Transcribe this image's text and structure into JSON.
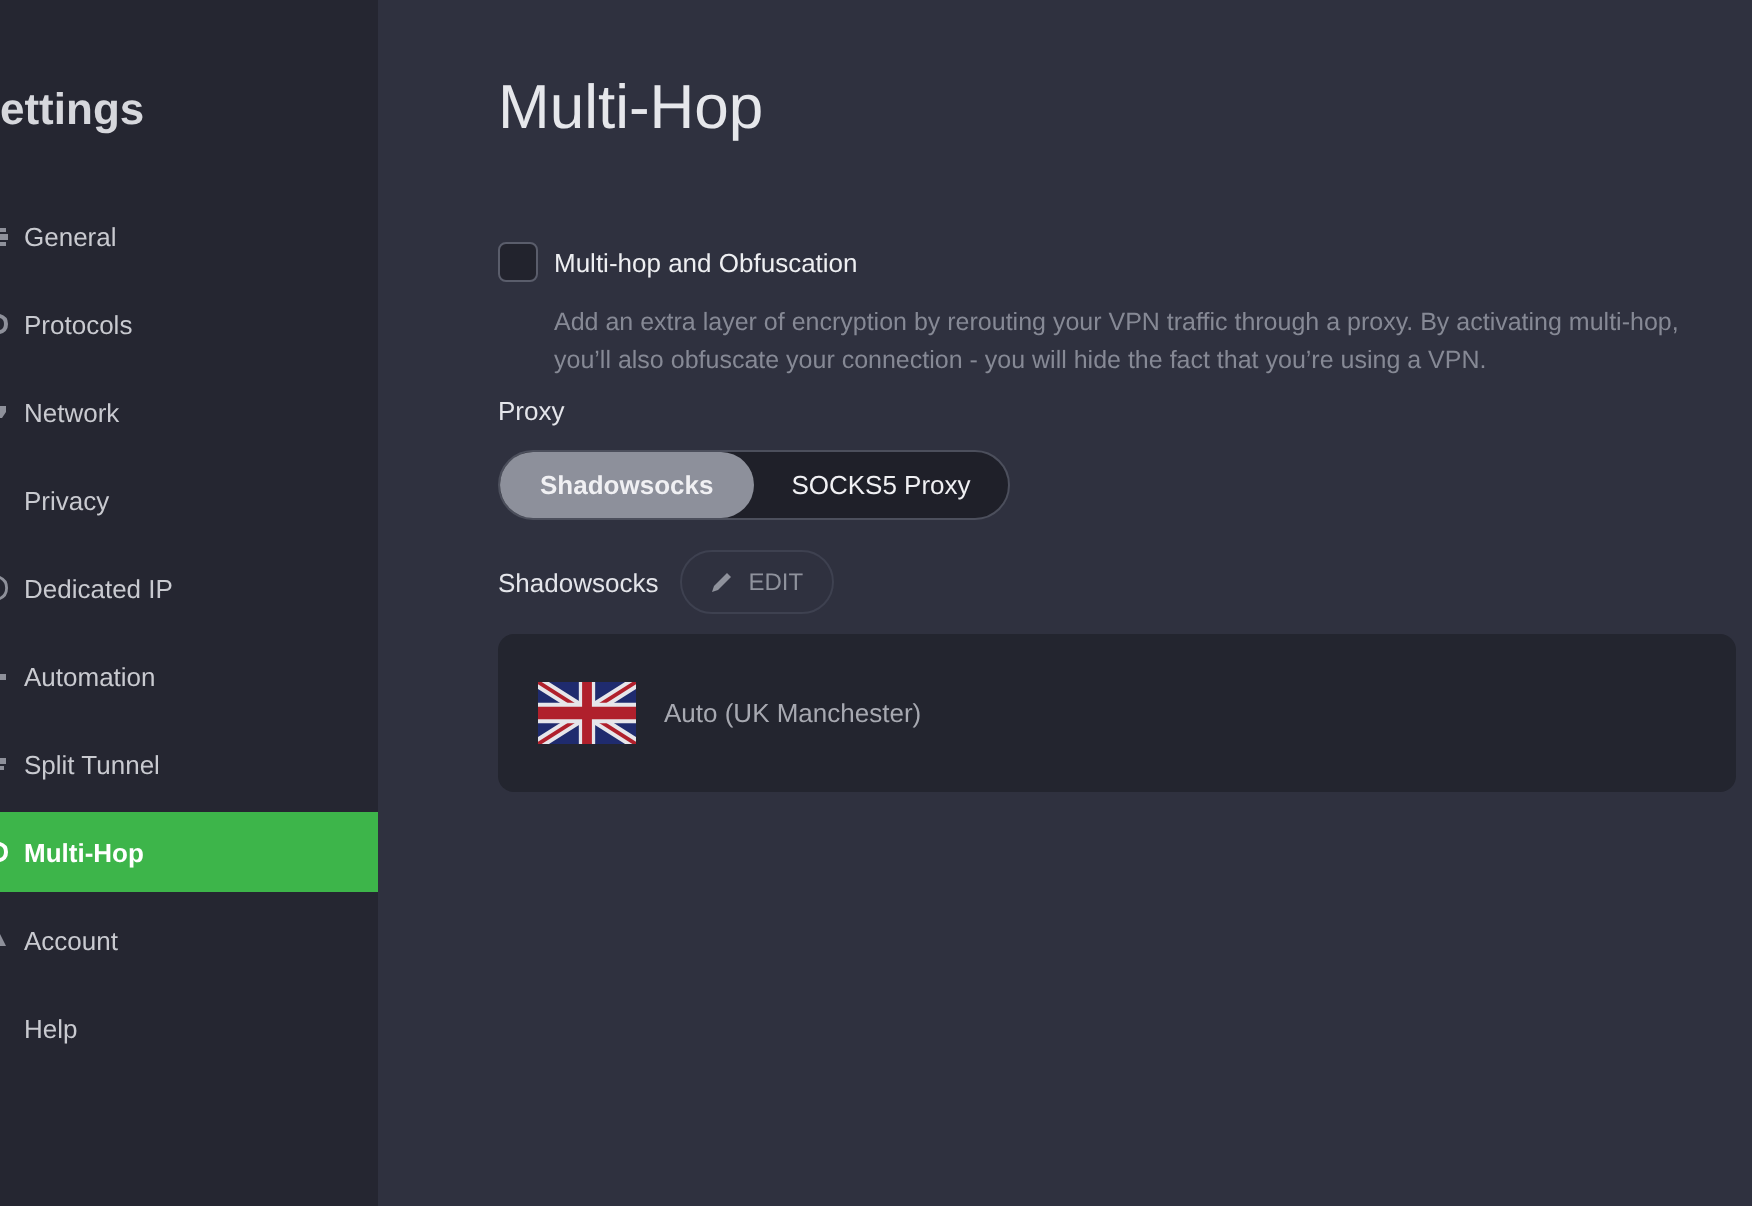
{
  "sidebar": {
    "title": "ettings",
    "items": [
      {
        "label": "General",
        "selected": false
      },
      {
        "label": "Protocols",
        "selected": false
      },
      {
        "label": "Network",
        "selected": false
      },
      {
        "label": "Privacy",
        "selected": false
      },
      {
        "label": "Dedicated IP",
        "selected": false
      },
      {
        "label": "Automation",
        "selected": false
      },
      {
        "label": "Split Tunnel",
        "selected": false
      },
      {
        "label": "Multi-Hop",
        "selected": true
      },
      {
        "label": "Account",
        "selected": false
      },
      {
        "label": "Help",
        "selected": false
      }
    ]
  },
  "page": {
    "title": "Multi-Hop"
  },
  "multihop": {
    "label": "Multi-hop and Obfuscation",
    "checked": false,
    "description": "Add an extra layer of encryption by rerouting your VPN traffic through a proxy. By activating multi-hop, you’ll also obfuscate your connection - you will hide the fact that you’re using a VPN."
  },
  "proxy": {
    "label": "Proxy",
    "options": [
      {
        "label": "Shadowsocks",
        "selected": true
      },
      {
        "label": "SOCKS5 Proxy",
        "selected": false
      }
    ]
  },
  "server": {
    "label": "Shadowsocks",
    "edit_button": "EDIT",
    "location": "Auto (UK Manchester)"
  }
}
